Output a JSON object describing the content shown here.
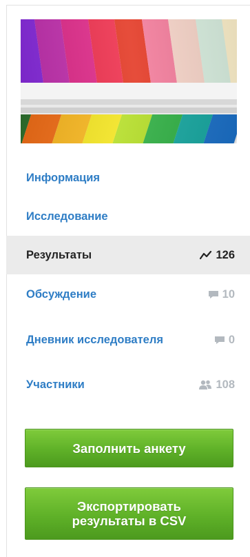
{
  "nav": {
    "items": [
      {
        "label": "Информация"
      },
      {
        "label": "Исследование"
      },
      {
        "label": "Результаты",
        "count": "126",
        "icon": "chart-line-icon",
        "active": true
      },
      {
        "label": "Обсуждение",
        "count": "10",
        "icon": "comment-icon"
      },
      {
        "label": "Дневник исследователя",
        "count": "0",
        "icon": "comment-icon"
      },
      {
        "label": "Участники",
        "count": "108",
        "icon": "users-icon"
      }
    ]
  },
  "actions": {
    "fill_survey_label": "Заполнить анкету",
    "export_csv_label": "Экспортировать результаты в CSV"
  },
  "colors": {
    "link": "#2e7dc5",
    "active_bg": "#ebebeb",
    "muted": "#b3b9bf",
    "button_green": "#5fb128"
  }
}
